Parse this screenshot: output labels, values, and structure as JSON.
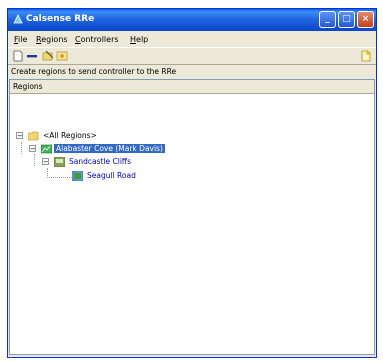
{
  "window": {
    "title": "Calsense RRe"
  },
  "menu": [
    {
      "label": "File"
    },
    {
      "label": "Regions"
    },
    {
      "label": "Controllers"
    },
    {
      "label": "Help"
    }
  ],
  "toolbar_hint": "Create regions to send controller to the RRe",
  "panel": {
    "header": "Regions"
  },
  "tree": {
    "root": "<All Regions>",
    "region": "Alabaster Cove (Mark Davis)",
    "controller": "Sandcastle Cliffs",
    "station": "Seagull Road"
  },
  "colors": {
    "titlebar": "#1f62e0",
    "selection": "#316ac5",
    "link_text": "#0000cc"
  }
}
